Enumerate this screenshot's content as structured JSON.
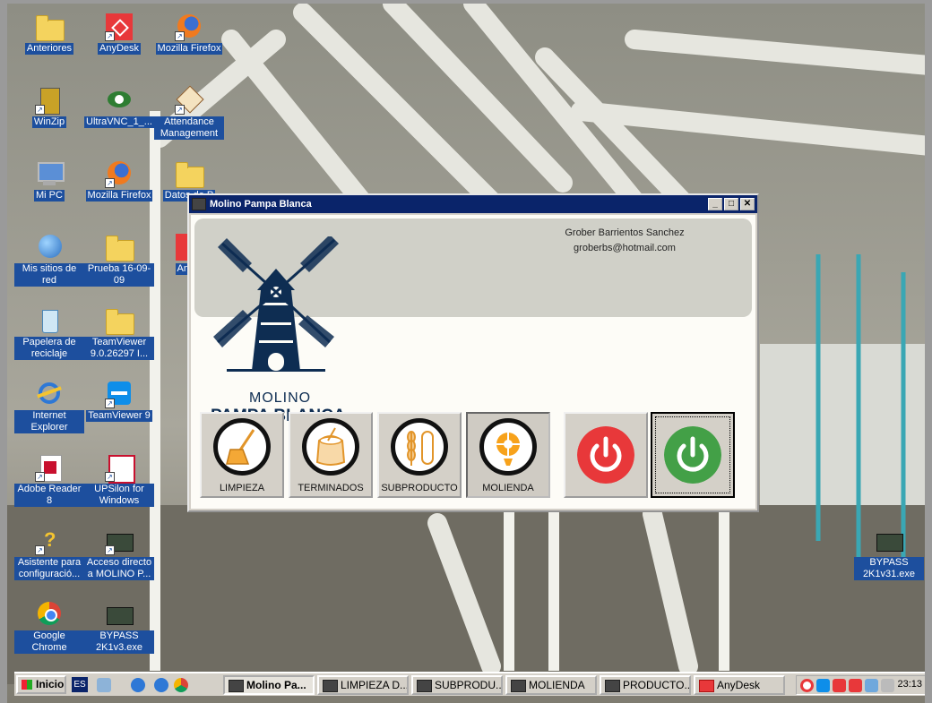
{
  "desktop": {
    "icons": [
      {
        "label": "Anteriores",
        "icon": "folder-icon"
      },
      {
        "label": "AnyDesk",
        "icon": "anydesk-icon"
      },
      {
        "label": "Mozilla Firefox",
        "icon": "firefox-icon"
      },
      {
        "label": "WinZip",
        "icon": "winzip-icon"
      },
      {
        "label": "UltraVNC_1_...",
        "icon": "ultravnc-icon"
      },
      {
        "label": "Attendance Management",
        "icon": "attendance-icon"
      },
      {
        "label": "Mi PC",
        "icon": "computer-icon"
      },
      {
        "label": "Mozilla Firefox",
        "icon": "firefox-icon"
      },
      {
        "label": "Datos de P",
        "icon": "folder-icon"
      },
      {
        "label": "Mis sitios de red",
        "icon": "network-icon"
      },
      {
        "label": "Prueba 16-09-09",
        "icon": "folder-icon"
      },
      {
        "label": "AnyD",
        "icon": "anydesk-icon"
      },
      {
        "label": "Papelera de reciclaje",
        "icon": "recycle-bin-icon"
      },
      {
        "label": "TeamViewer 9.0.26297 I...",
        "icon": "folder-icon"
      },
      {
        "label": "Internet Explorer",
        "icon": "ie-icon"
      },
      {
        "label": "TeamViewer 9",
        "icon": "teamviewer-icon"
      },
      {
        "label": "Adobe Reader 8",
        "icon": "adobe-reader-icon"
      },
      {
        "label": "UPSilon for Windows",
        "icon": "upsilon-icon"
      },
      {
        "label": "Asistente para configuració...",
        "icon": "wizard-icon"
      },
      {
        "label": "Acceso directo a MOLINO P...",
        "icon": "plc-icon"
      },
      {
        "label": "Google Chrome",
        "icon": "chrome-icon"
      },
      {
        "label": "BYPASS 2K1v3.exe",
        "icon": "plc-icon"
      },
      {
        "label": "BYPASS 2K1v31.exe",
        "icon": "plc-icon"
      }
    ]
  },
  "window": {
    "title": "Molino Pampa Blanca",
    "author_name": "Grober Barrientos Sanchez",
    "author_email": "groberbs@hotmail.com",
    "logo_line1": "MOLINO",
    "logo_line2": "PAMPA BLANCA",
    "buttons": [
      {
        "label": "LIMPIEZA",
        "icon": "broom-icon"
      },
      {
        "label": "TERMINADOS",
        "icon": "flour-sack-icon"
      },
      {
        "label": "SUBPRODUCTO",
        "icon": "wheat-icon"
      },
      {
        "label": "MOLIENDA",
        "icon": "mill-wheel-icon"
      }
    ],
    "power_off_color": "#e8383a",
    "power_on_color": "#43a047"
  },
  "taskbar": {
    "start_label": "Inicio",
    "lang": "ES",
    "tasks": [
      "Molino Pa...",
      "LIMPIEZA D...",
      "SUBPRODU...",
      "MOLIENDA",
      "PRODUCTO...",
      "AnyDesk"
    ],
    "clock": "23:13"
  }
}
